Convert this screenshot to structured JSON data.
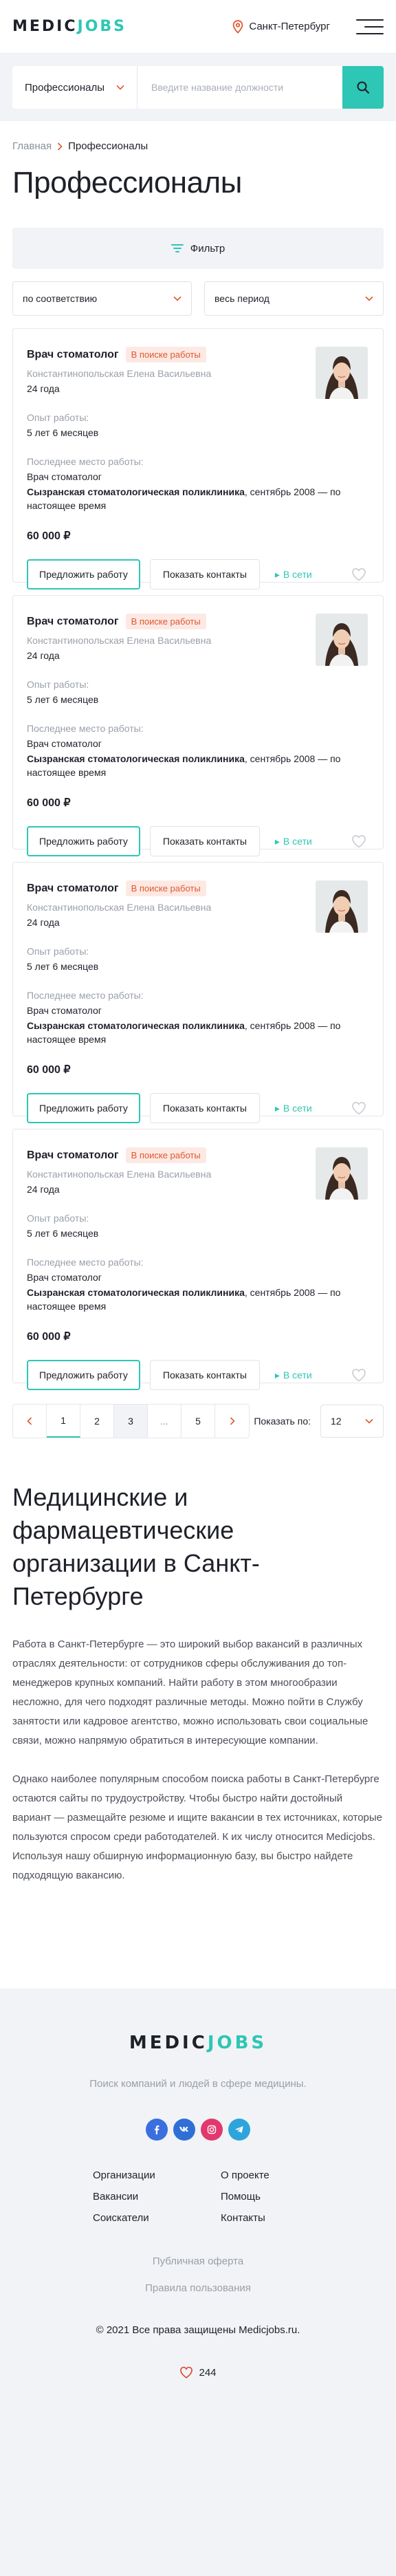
{
  "colors": {
    "accent": "#2ec6b4",
    "badge_text": "#e0572f",
    "badge_bg": "#fde9e3",
    "heart": "#e0452f",
    "online": "#2ec6b4"
  },
  "header": {
    "logo_part1": "MEDIC",
    "logo_part2": "JOBS",
    "city": "Санкт-Петербург",
    "icons": {
      "location": "map-pin-icon",
      "menu": "hamburger-menu-icon"
    }
  },
  "search": {
    "category_value": "Профессионалы",
    "placeholder": "Введите название должности",
    "icon": "search-icon"
  },
  "breadcrumb": {
    "home": "Главная",
    "current": "Профессионалы"
  },
  "page_title": "Профессионалы",
  "filter": {
    "label": "Фильтр",
    "icon": "filter-icon"
  },
  "sort": {
    "order_value": "по соответствию",
    "period_value": "весь период"
  },
  "labels": {
    "experience": "Опыт работы:",
    "last_place": "Последнее место работы:",
    "offer_button": "Предложить работу",
    "contacts_button": "Показать контакты",
    "online": "В сети"
  },
  "cards": [
    {
      "title": "Врач стоматолог",
      "status": "В поиске работы",
      "name": "Константинопольская Елена Васильевна",
      "age": "24 года",
      "experience": "5 лет 6 месяцев",
      "position": "Врач стоматолог",
      "clinic": "Сызранская стоматологическая поликлиника",
      "period": ", сентябрь 2008 — по настоящее время",
      "salary": "60 000 ₽"
    },
    {
      "title": "Врач стоматолог",
      "status": "В поиске работы",
      "name": "Константинопольская Елена Васильевна",
      "age": "24 года",
      "experience": "5 лет 6 месяцев",
      "position": "Врач стоматолог",
      "clinic": "Сызранская стоматологическая поликлиника",
      "period": ", сентябрь 2008 — по настоящее время",
      "salary": "60 000 ₽"
    },
    {
      "title": "Врач стоматолог",
      "status": "В поиске работы",
      "name": "Константинопольская Елена Васильевна",
      "age": "24 года",
      "experience": "5 лет 6 месяцев",
      "position": "Врач стоматолог",
      "clinic": "Сызранская стоматологическая поликлиника",
      "period": ", сентябрь 2008 — по настоящее время",
      "salary": "60 000 ₽"
    },
    {
      "title": "Врач стоматолог",
      "status": "В поиске работы",
      "name": "Константинопольская Елена Васильевна",
      "age": "24 года",
      "experience": "5 лет 6 месяцев",
      "position": "Врач стоматолог",
      "clinic": "Сызранская стоматологическая поликлиника",
      "period": ", сентябрь 2008 — по настоящее время",
      "salary": "60 000 ₽"
    }
  ],
  "pagination": {
    "pages": [
      "1",
      "2",
      "3",
      "...",
      "5"
    ],
    "current_page": "1",
    "per_page_label": "Показать по:",
    "per_page_value": "12"
  },
  "seo": {
    "title": "Медицинские и фармацевтические организации в Санкт-Петербурге",
    "paragraph1": "Работа в Санкт-Петербурге — это широкий выбор вакансий в различных отраслях деятельности: от сотрудников сферы обслуживания до топ-менеджеров крупных компаний. Найти работу в этом многообразии несложно, для чего подходят различные методы. Можно пойти в Службу занятости или кадровое агентство, можно использовать свои социальные связи, можно напрямую обратиться в интересующие компании.",
    "paragraph2": "Однако наиболее популярным способом поиска работы в Санкт-Петербурге остаются сайты по трудоустройству. Чтобы быстро найти достойный вариант — размещайте резюме и ищите вакансии в тех источниках, которые пользуются спросом среди работодателей. К их числу относится Medicjobs. Используя нашу обширную информационную базу, вы быстро найдете подходящую вакансию."
  },
  "footer": {
    "tagline": "Поиск компаний и людей в сфере медицины.",
    "socials": [
      {
        "icon": "facebook-icon",
        "color": "#3b6fe0"
      },
      {
        "icon": "vk-icon",
        "color": "#2f6fd6"
      },
      {
        "icon": "instagram-icon",
        "color": "#e2386e"
      },
      {
        "icon": "telegram-icon",
        "color": "#2ea4dc"
      }
    ],
    "links": [
      "Организации",
      "О проекте",
      "Вакансии",
      "Помощь",
      "Соискатели",
      "Контакты"
    ],
    "offer": "Публичная оферта",
    "rules": "Правила пользования",
    "copyright": "© 2021 Все права защищены Medicjobs.ru.",
    "likes": "244"
  }
}
